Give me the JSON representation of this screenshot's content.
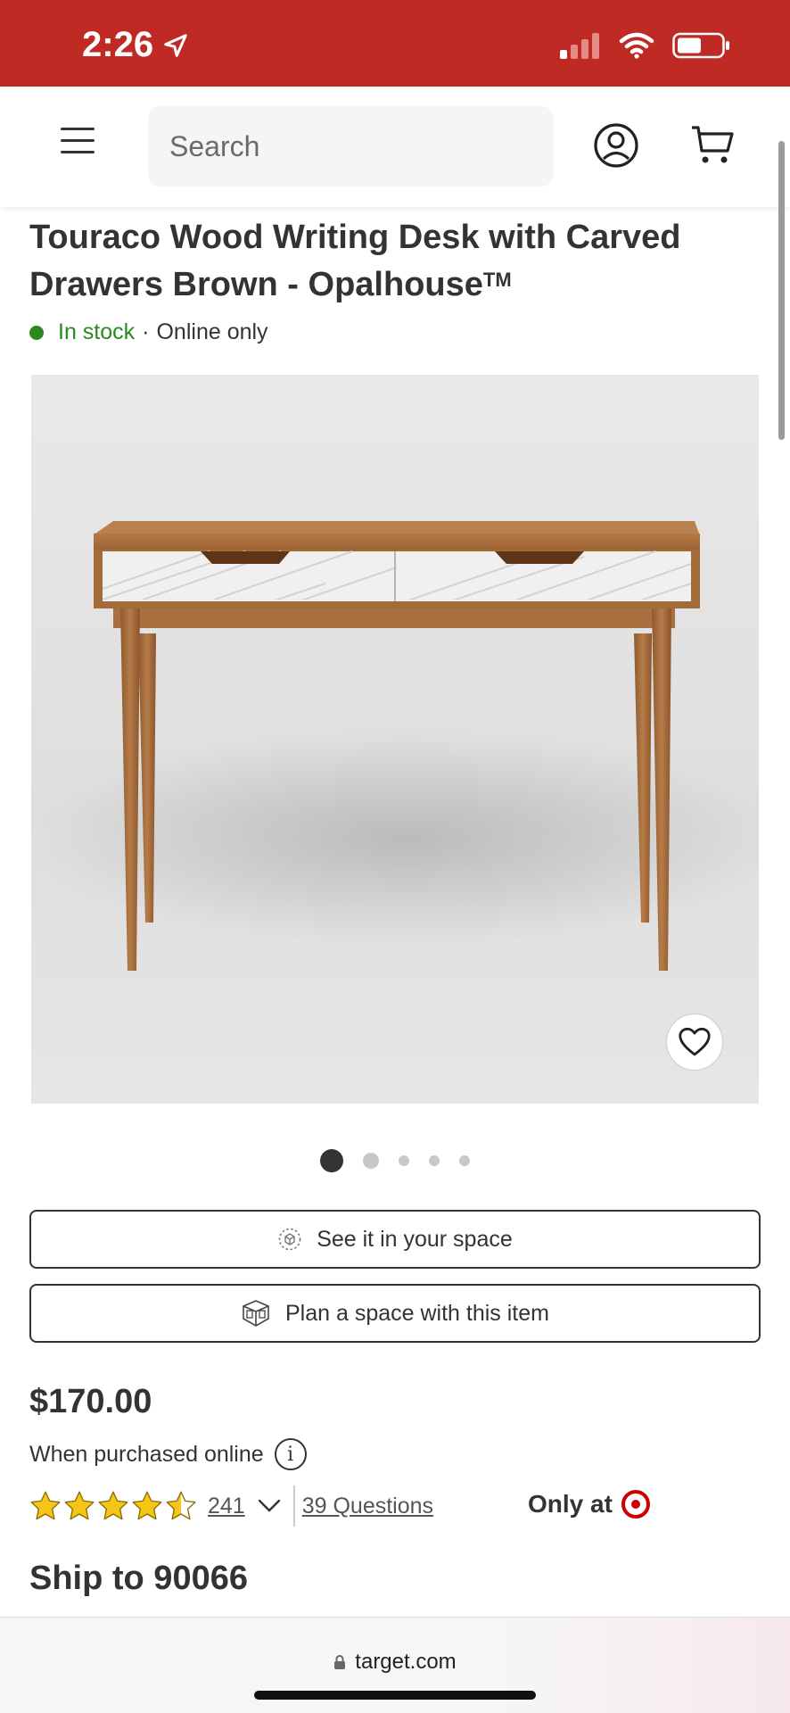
{
  "status_bar": {
    "time": "2:26"
  },
  "header": {
    "search_placeholder": "Search"
  },
  "product": {
    "title": "Touraco Wood Writing Desk with Carved Drawers Brown - Opalhouse",
    "trademark": "TM",
    "stock_status": "In stock",
    "availability": "Online only",
    "image_count": 5,
    "active_image_index": 0
  },
  "actions": {
    "see_in_space": "See it in your space",
    "plan_space": "Plan a space with this item"
  },
  "pricing": {
    "price": "$170.00",
    "price_note": "When purchased online"
  },
  "rating": {
    "stars": 4.5,
    "count": "241",
    "questions": "39 Questions"
  },
  "exclusive": {
    "label": "Only at"
  },
  "shipping": {
    "ship_to": "Ship to 90066"
  },
  "browser": {
    "url": "target.com"
  },
  "colors": {
    "brand_red": "#bf2a24",
    "in_stock_green": "#2a8a1e",
    "star_yellow": "#f5c518"
  }
}
